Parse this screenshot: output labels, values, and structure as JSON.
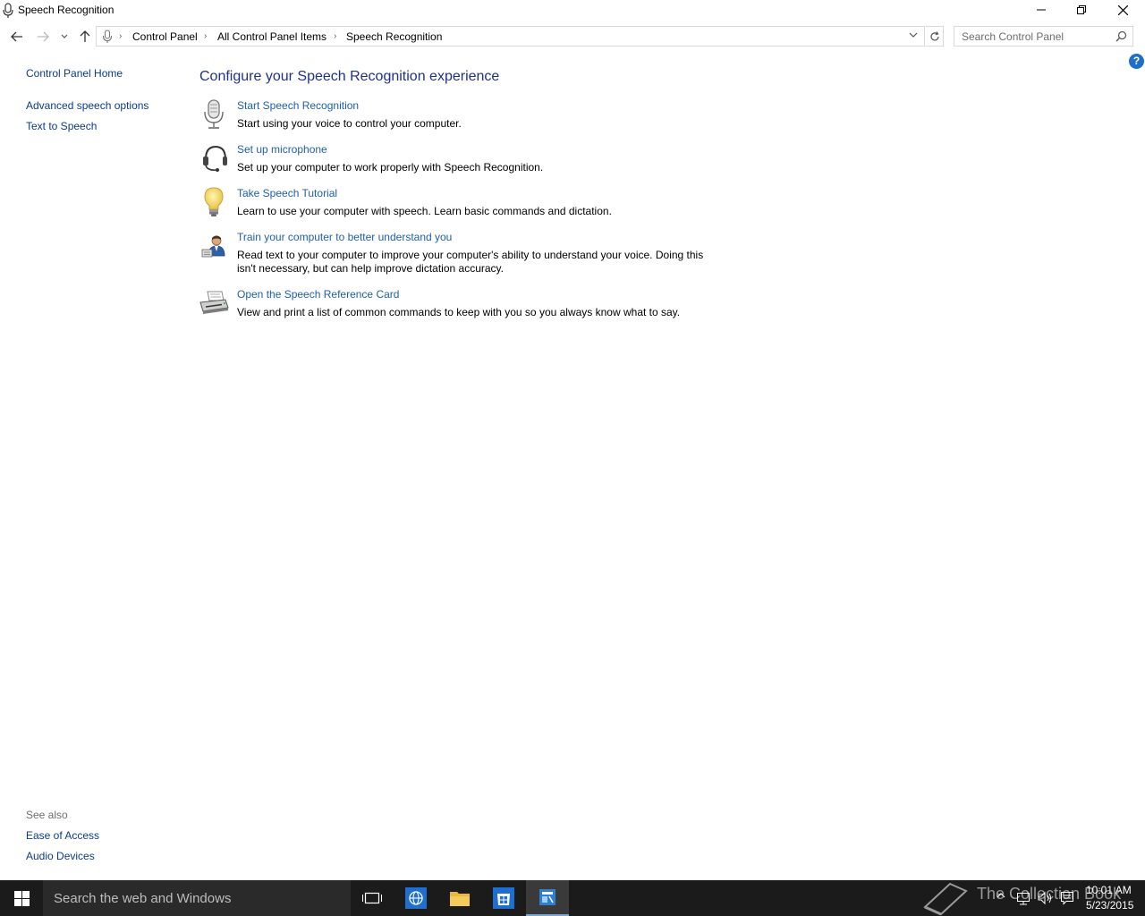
{
  "window": {
    "title": "Speech Recognition"
  },
  "address": {
    "breadcrumbs": [
      "Control Panel",
      "All Control Panel Items",
      "Speech Recognition"
    ],
    "search_placeholder": "Search Control Panel"
  },
  "help": {
    "label": "?"
  },
  "sidebar": {
    "home": "Control Panel Home",
    "links": [
      "Advanced speech options",
      "Text to Speech"
    ],
    "see_also_title": "See also",
    "see_also": [
      "Ease of Access",
      "Audio Devices"
    ]
  },
  "main": {
    "heading": "Configure your Speech Recognition experience",
    "tasks": [
      {
        "icon": "microphone-icon",
        "title": "Start Speech Recognition",
        "desc": "Start using your voice to control your computer."
      },
      {
        "icon": "headset-icon",
        "title": "Set up microphone",
        "desc": "Set up your computer to work properly with Speech Recognition."
      },
      {
        "icon": "lightbulb-icon",
        "title": "Take Speech Tutorial",
        "desc": "Learn to use your computer with speech.  Learn basic commands and dictation."
      },
      {
        "icon": "user-training-icon",
        "title": "Train your computer to better understand you",
        "desc": "Read text to your computer to improve your computer's ability to understand your voice.  Doing this isn't necessary, but can help improve dictation accuracy."
      },
      {
        "icon": "printer-icon",
        "title": "Open the Speech Reference Card",
        "desc": "View and print a list of common commands to keep with you so you always know what to say."
      }
    ]
  },
  "taskbar": {
    "search_placeholder": "Search the web and Windows",
    "time": "10:01 AM",
    "date": "5/23/2015",
    "watermark": "The Collection Book"
  },
  "colors": {
    "link": "#1f5fae",
    "heading": "#1e3287",
    "taskbar": "#1b1b1b"
  }
}
